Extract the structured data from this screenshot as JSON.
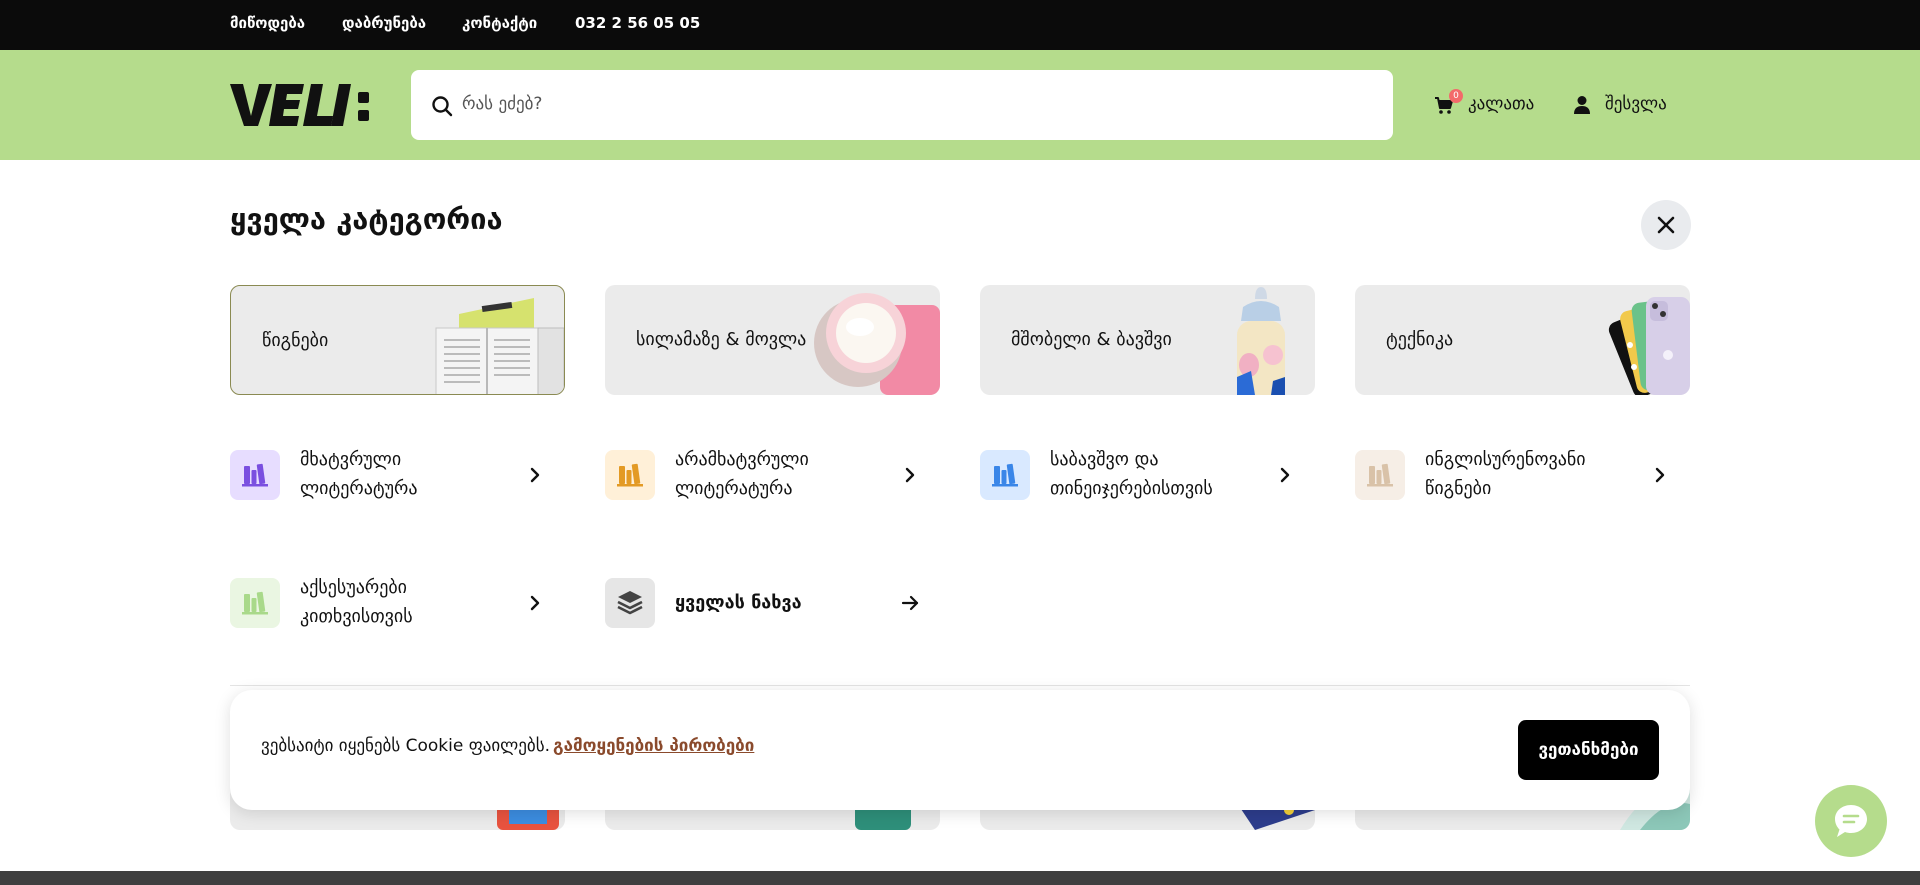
{
  "topbar": {
    "links": [
      "მიწოდება",
      "დაბრუნება",
      "კონტაქტი"
    ],
    "phone": "032 2 56 05 05"
  },
  "header": {
    "search_placeholder": "რას ეძებ?",
    "cart_label": "კალათა",
    "cart_count": "0",
    "login_label": "შესვლა"
  },
  "panel": {
    "title": "ყველა კატეგორია",
    "categories": [
      {
        "label": "წიგნები",
        "active": true
      },
      {
        "label": "სილამაზე & მოვლა",
        "active": false
      },
      {
        "label": "მშობელი & ბავშვი",
        "active": false
      },
      {
        "label": "ტექნიკა",
        "active": false
      }
    ],
    "subcategories": [
      {
        "line1": "მხატვრული",
        "line2": "ლიტერატურა",
        "icon": "books-icon",
        "color": "#7a4fe0",
        "bg": "#e7ddff"
      },
      {
        "line1": "არამხატვრული",
        "line2": "ლიტერატურა",
        "icon": "books-icon",
        "color": "#e39a24",
        "bg": "#fff0d8"
      },
      {
        "line1": "საბავშვო და",
        "line2": "თინეიჯერებისთვის",
        "icon": "books-icon",
        "color": "#3a86e8",
        "bg": "#d9e9ff"
      },
      {
        "line1": "ინგლისურენოვანი",
        "line2": "წიგნები",
        "icon": "books-icon",
        "color": "#d9c2a8",
        "bg": "#f6eee6"
      },
      {
        "line1": "აქსესუარები",
        "line2": "კითხვისთვის",
        "icon": "books-icon",
        "color": "#a9d98a",
        "bg": "#eaf6e2"
      }
    ],
    "see_all": {
      "label": "ყველას ნახვა",
      "icon": "layers-icon"
    }
  },
  "cookie": {
    "text": "ვებსაიტი იყენებს Cookie ფაილებს.",
    "link": "გამოყენების პირობები",
    "accept": "ვეთანხმები"
  },
  "colors": {
    "header_bg": "#b5dc8c",
    "topbar_bg": "#0b0b0b",
    "cookie_link": "#8a4a2c",
    "badge": "#f36a6a"
  }
}
